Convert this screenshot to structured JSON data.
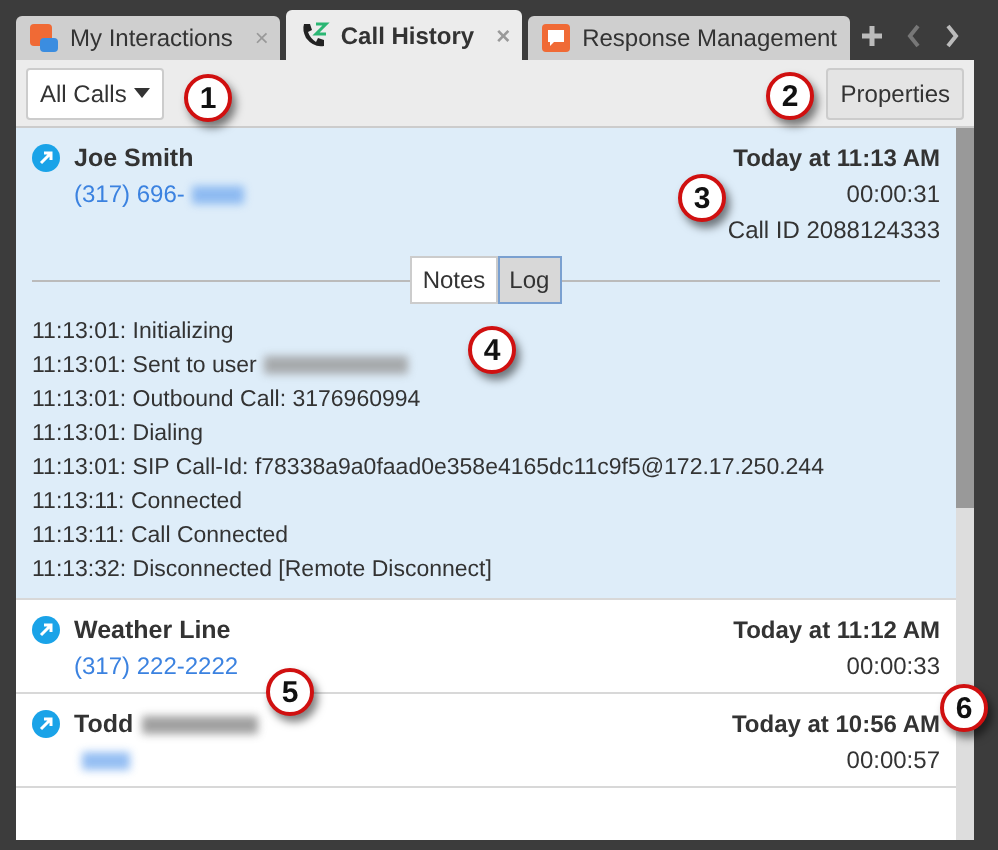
{
  "tabs": [
    {
      "label": "My Interactions",
      "selected": false,
      "close": "×"
    },
    {
      "label": "Call History",
      "selected": true,
      "close": "×"
    },
    {
      "label": "Response Management",
      "selected": false
    }
  ],
  "toolbar": {
    "filter": "All Calls",
    "properties_button": "Properties"
  },
  "calls": [
    {
      "name": "Joe Smith",
      "phone": "(317) 696-",
      "phone_redacted": true,
      "time": "Today at 11:13 AM",
      "duration": "00:00:31",
      "call_id": "Call ID 2088124333",
      "expanded": true,
      "detail_tabs": [
        {
          "label": "Notes",
          "selected": false
        },
        {
          "label": "Log",
          "selected": true
        }
      ],
      "log": [
        {
          "text": "11:13:01: Initializing"
        },
        {
          "text": "11:13:01: Sent to user",
          "redacted": true
        },
        {
          "text": "11:13:01: Outbound Call:  3176960994"
        },
        {
          "text": "11:13:01: Dialing"
        },
        {
          "text": "11:13:01: SIP Call-Id: f78338a9a0faad0e358e4165dc11c9f5@172.17.250.244"
        },
        {
          "text": "11:13:11: Connected"
        },
        {
          "text": "11:13:11: Call Connected"
        },
        {
          "text": "11:13:32: Disconnected [Remote Disconnect]"
        }
      ]
    },
    {
      "name": "Weather Line",
      "phone": "(317) 222-2222",
      "time": "Today at 11:12 AM",
      "duration": "00:00:33",
      "expanded": false
    },
    {
      "name": "Todd",
      "name_redacted": true,
      "phone_redacted": true,
      "time": "Today at 10:56 AM",
      "duration": "00:00:57",
      "expanded": false
    }
  ],
  "callouts": [
    "1",
    "2",
    "3",
    "4",
    "5",
    "6"
  ]
}
